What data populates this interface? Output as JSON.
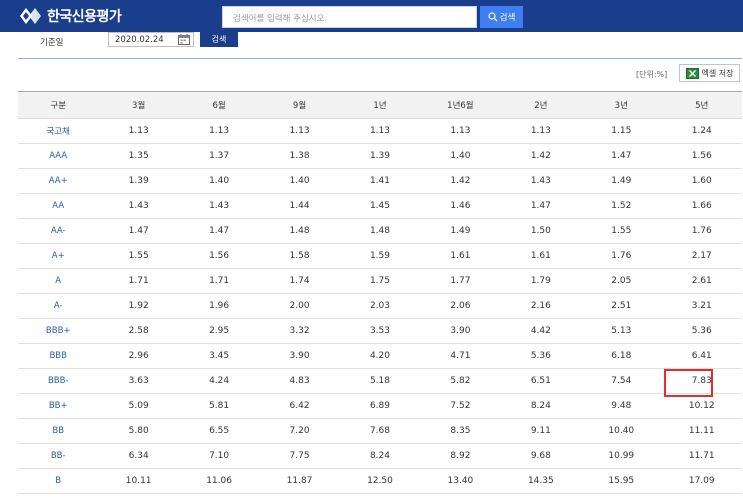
{
  "header": {
    "logo_text": "한국신용평가",
    "search_placeholder": "검색어를 입력해 주십시오.",
    "search_button": "검색"
  },
  "filter": {
    "date_label": "기준일",
    "date_value": "2020.02.24",
    "search_button": "검색"
  },
  "toolbar": {
    "unit_label": "[단위:%]",
    "excel_button": "엑셀 저장"
  },
  "table": {
    "headers": [
      "구분",
      "3월",
      "6월",
      "9월",
      "1년",
      "1년6월",
      "2년",
      "3년",
      "5년"
    ],
    "rows": [
      {
        "grade": "국고채",
        "values": [
          "1.13",
          "1.13",
          "1.13",
          "1.13",
          "1.13",
          "1.13",
          "1.15",
          "1.24"
        ]
      },
      {
        "grade": "AAA",
        "values": [
          "1.35",
          "1.37",
          "1.38",
          "1.39",
          "1.40",
          "1.42",
          "1.47",
          "1.56"
        ]
      },
      {
        "grade": "AA+",
        "values": [
          "1.39",
          "1.40",
          "1.40",
          "1.41",
          "1.42",
          "1.43",
          "1.49",
          "1.60"
        ]
      },
      {
        "grade": "AA",
        "values": [
          "1.43",
          "1.43",
          "1.44",
          "1.45",
          "1.46",
          "1.47",
          "1.52",
          "1.66"
        ]
      },
      {
        "grade": "AA-",
        "values": [
          "1.47",
          "1.47",
          "1.48",
          "1.48",
          "1.49",
          "1.50",
          "1.55",
          "1.76"
        ]
      },
      {
        "grade": "A+",
        "values": [
          "1.55",
          "1.56",
          "1.58",
          "1.59",
          "1.61",
          "1.61",
          "1.76",
          "2.17"
        ]
      },
      {
        "grade": "A",
        "values": [
          "1.71",
          "1.71",
          "1.74",
          "1.75",
          "1.77",
          "1.79",
          "2.05",
          "2.61"
        ]
      },
      {
        "grade": "A-",
        "values": [
          "1.92",
          "1.96",
          "2.00",
          "2.03",
          "2.06",
          "2.16",
          "2.51",
          "3.21"
        ]
      },
      {
        "grade": "BBB+",
        "values": [
          "2.58",
          "2.95",
          "3.32",
          "3.53",
          "3.90",
          "4.42",
          "5.13",
          "5.36"
        ]
      },
      {
        "grade": "BBB",
        "values": [
          "2.96",
          "3.45",
          "3.90",
          "4.20",
          "4.71",
          "5.36",
          "6.18",
          "6.41"
        ]
      },
      {
        "grade": "BBB-",
        "values": [
          "3.63",
          "4.24",
          "4.83",
          "5.18",
          "5.82",
          "6.51",
          "7.54",
          "7.83"
        ]
      },
      {
        "grade": "BB+",
        "values": [
          "5.09",
          "5.81",
          "6.42",
          "6.89",
          "7.52",
          "8.24",
          "9.48",
          "10.12"
        ]
      },
      {
        "grade": "BB",
        "values": [
          "5.80",
          "6.55",
          "7.20",
          "7.68",
          "8.35",
          "9.11",
          "10.40",
          "11.11"
        ]
      },
      {
        "grade": "BB-",
        "values": [
          "6.34",
          "7.10",
          "7.75",
          "8.24",
          "8.92",
          "9.68",
          "10.99",
          "11.71"
        ]
      },
      {
        "grade": "B",
        "values": [
          "10.11",
          "11.06",
          "11.87",
          "12.50",
          "13.40",
          "14.35",
          "15.95",
          "17.09"
        ]
      }
    ],
    "highlight": {
      "row": 10,
      "col": 7,
      "color": "#e52b2b"
    }
  },
  "colors": {
    "brand": "#1a3e8c",
    "accent": "#3f7ef0",
    "grade_text": "#2a5ca8"
  }
}
